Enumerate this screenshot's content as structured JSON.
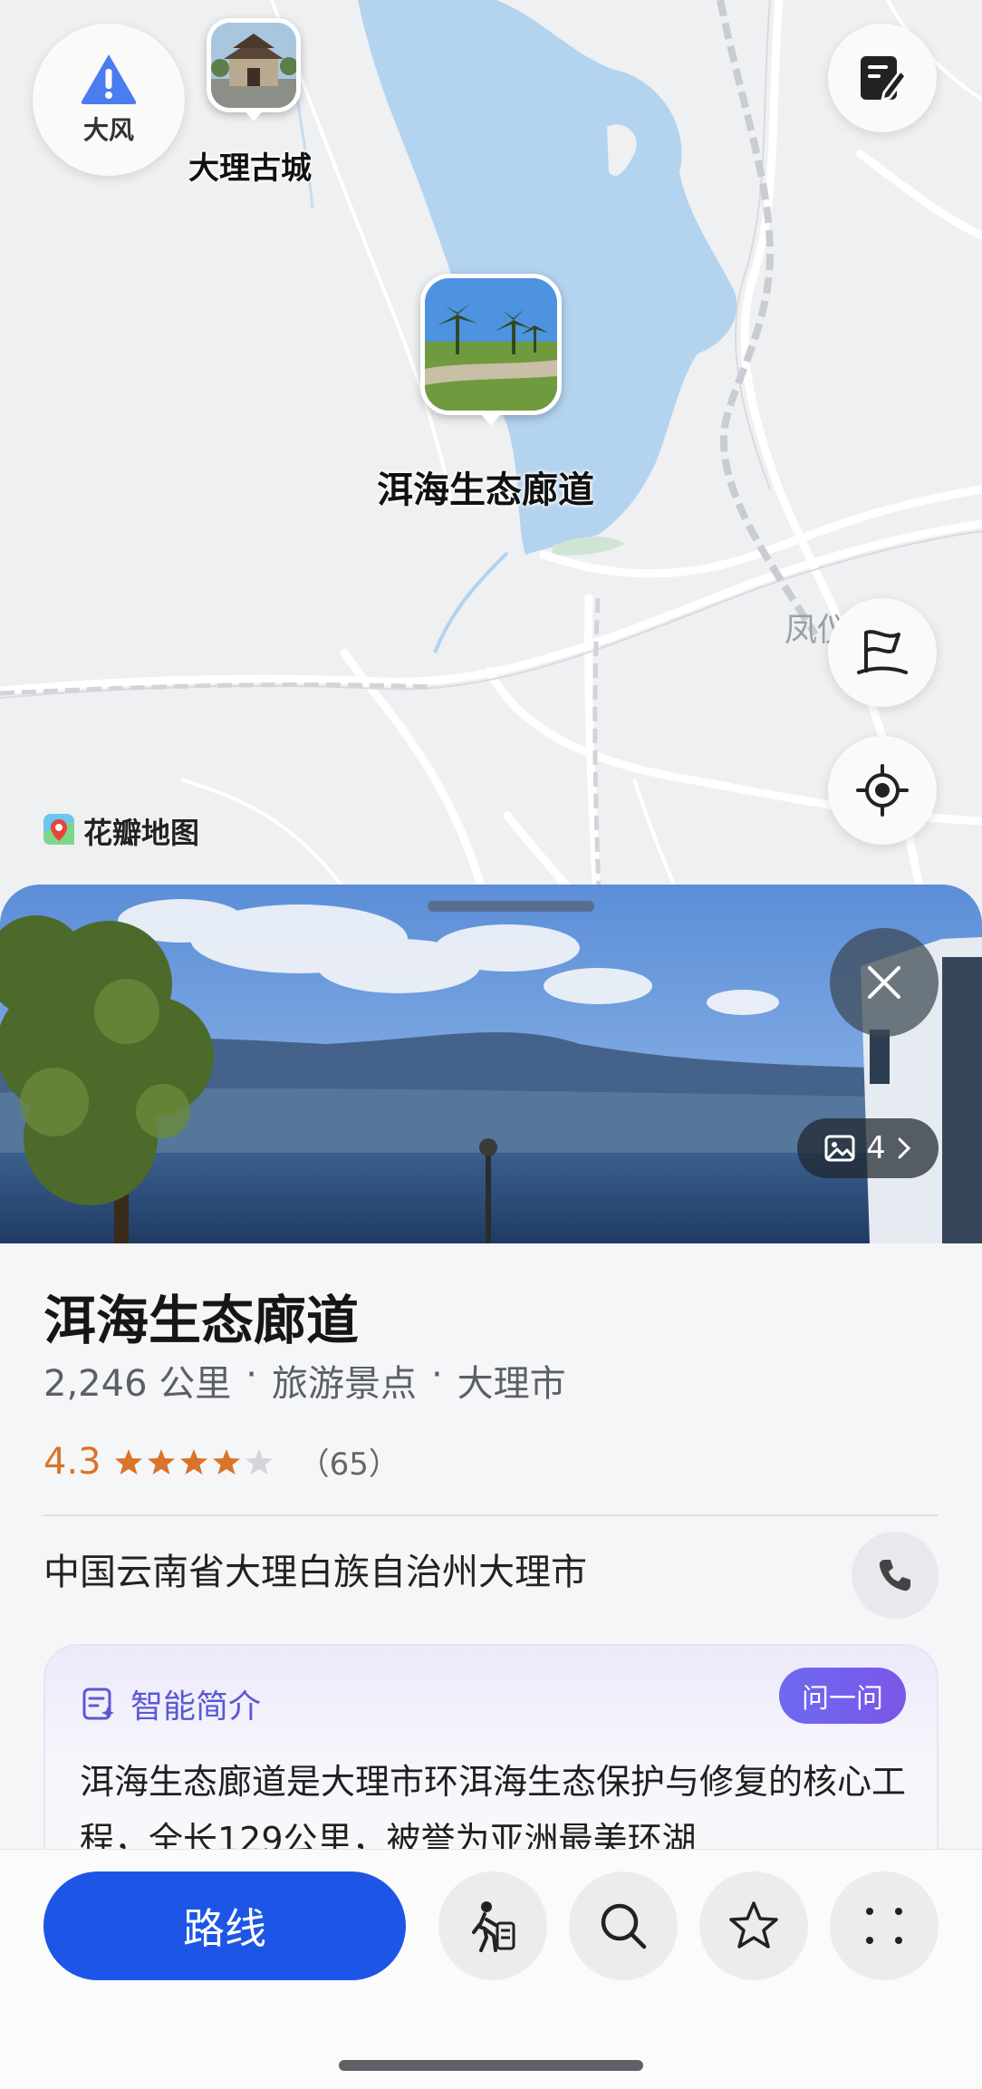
{
  "map": {
    "weather_alert": {
      "label": "大风",
      "icon": "warning-icon",
      "color": "#4a7df0"
    },
    "pois": [
      {
        "name": "大理古城"
      },
      {
        "name": "洱海生态廊道"
      }
    ],
    "town_label": "凤仪",
    "brand": "花瓣地图",
    "colors": {
      "lake": "#b3d3ef",
      "land": "#eef0f2",
      "road": "#ffffff"
    }
  },
  "sheet": {
    "photo_count": "4",
    "title": "洱海生态廊道",
    "distance": "2,246 公里",
    "category": "旅游景点",
    "city": "大理市",
    "separator": "·",
    "rating": {
      "score": "4.3",
      "stars": 4.3,
      "max": 5,
      "count": "（65）",
      "color": "#d9742b"
    },
    "address": "中国云南省大理白族自治州大理市",
    "ai_intro": {
      "label": "智能简介",
      "ask_button": "问一问",
      "text": "洱海生态廊道是大理市环洱海生态保护与修复的核心工程，全长129公里，被誉为亚洲最美环湖"
    }
  },
  "actions": {
    "route_label": "路线",
    "buttons": [
      "walk-icon",
      "search-icon",
      "star-icon",
      "more-icon"
    ],
    "accent": "#1d56e6"
  }
}
